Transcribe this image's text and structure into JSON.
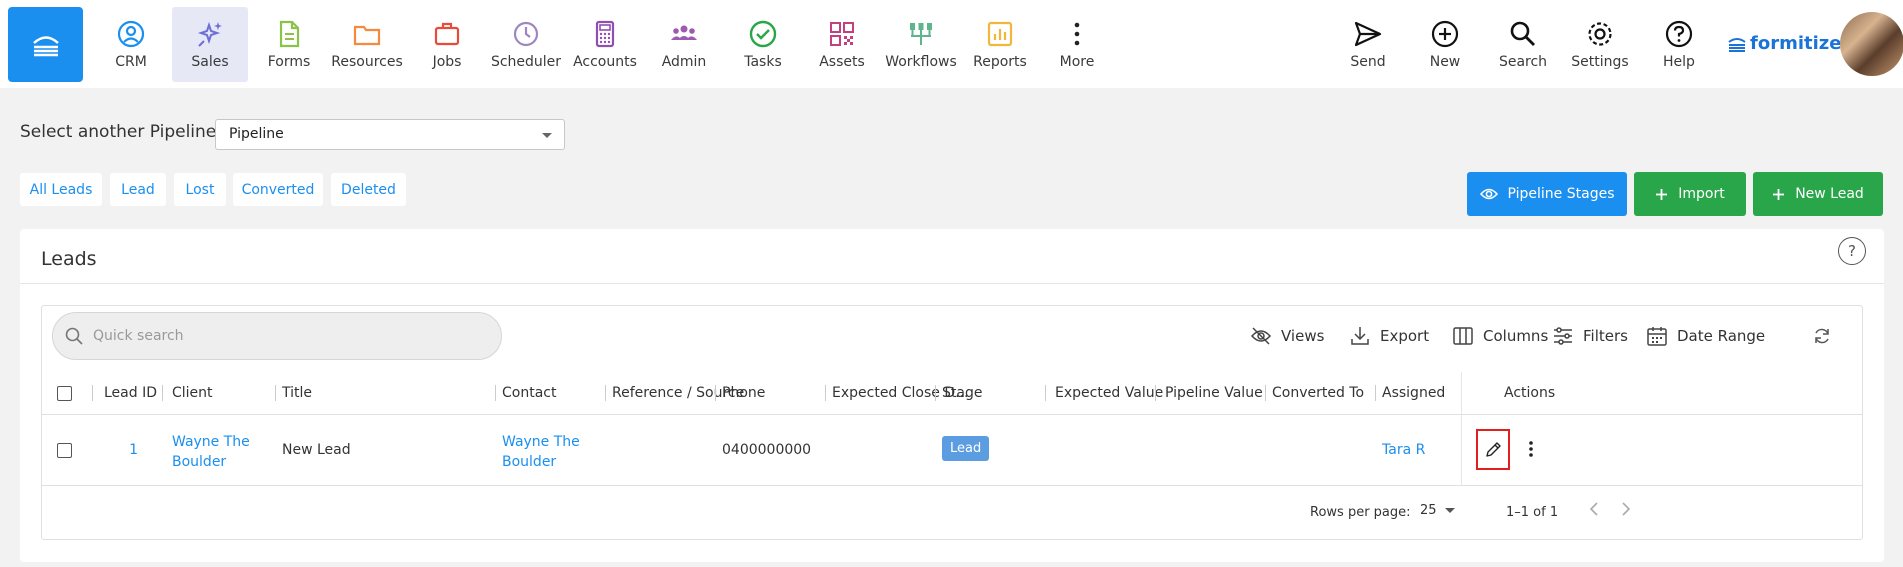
{
  "nav": {
    "items": [
      {
        "label": "CRM",
        "icon": "user-circle-icon",
        "color": "#1a8ff0"
      },
      {
        "label": "Sales",
        "icon": "sparkle-icon",
        "color": "#6e6ed8",
        "active": true
      },
      {
        "label": "Forms",
        "icon": "document-icon",
        "color": "#8bc34a"
      },
      {
        "label": "Resources",
        "icon": "folder-icon",
        "color": "#f5893d"
      },
      {
        "label": "Jobs",
        "icon": "briefcase-icon",
        "color": "#e84a3c"
      },
      {
        "label": "Scheduler",
        "icon": "clock-icon",
        "color": "#9c87c4"
      },
      {
        "label": "Accounts",
        "icon": "calculator-icon",
        "color": "#8e4fb0"
      },
      {
        "label": "Admin",
        "icon": "group-icon",
        "color": "#9c5bb0"
      },
      {
        "label": "Tasks",
        "icon": "check-circle-icon",
        "color": "#2aa64a"
      },
      {
        "label": "Assets",
        "icon": "qr-code-icon",
        "color": "#c2407e"
      },
      {
        "label": "Workflows",
        "icon": "workflow-icon",
        "color": "#5fb58b"
      },
      {
        "label": "Reports",
        "icon": "chart-icon",
        "color": "#f2b63a"
      },
      {
        "label": "More",
        "icon": "more-vertical-icon",
        "color": "#222222"
      }
    ],
    "right": [
      {
        "label": "Send",
        "icon": "send-icon"
      },
      {
        "label": "New",
        "icon": "plus-circle-icon"
      },
      {
        "label": "Search",
        "icon": "search-icon"
      },
      {
        "label": "Settings",
        "icon": "gear-icon"
      },
      {
        "label": "Help",
        "icon": "help-icon"
      }
    ],
    "brand": "formitize"
  },
  "pipeline": {
    "label": "Select another Pipeline:",
    "selected": "Pipeline"
  },
  "filters": [
    "All Leads",
    "Lead",
    "Lost",
    "Converted",
    "Deleted"
  ],
  "buttons": {
    "pipeline_stages": "Pipeline Stages",
    "import": "Import",
    "new_lead": "New Lead"
  },
  "card": {
    "title": "Leads",
    "search_placeholder": "Quick search",
    "tools": {
      "views": "Views",
      "export": "Export",
      "columns": "Columns",
      "filters": "Filters",
      "date_range": "Date Range"
    },
    "columns": [
      "Lead ID",
      "Client",
      "Title",
      "Contact",
      "Reference / Source",
      "Phone",
      "Expected Close D...",
      "Stage",
      "Expected Value",
      "Pipeline Value",
      "Converted To",
      "Assigned",
      "Actions"
    ],
    "rows": [
      {
        "lead_id": "1",
        "client_line1": "Wayne The",
        "client_line2": "Boulder",
        "title": "New Lead",
        "contact_line1": "Wayne The",
        "contact_line2": "Boulder",
        "reference": "",
        "phone": "0400000000",
        "expected_close": "",
        "stage": "Lead",
        "expected_value": "",
        "pipeline_value": "",
        "converted_to": "",
        "assigned": "Tara R"
      }
    ],
    "footer": {
      "rows_per_page_label": "Rows per page:",
      "rows_per_page": "25",
      "range": "1–1 of 1"
    }
  }
}
